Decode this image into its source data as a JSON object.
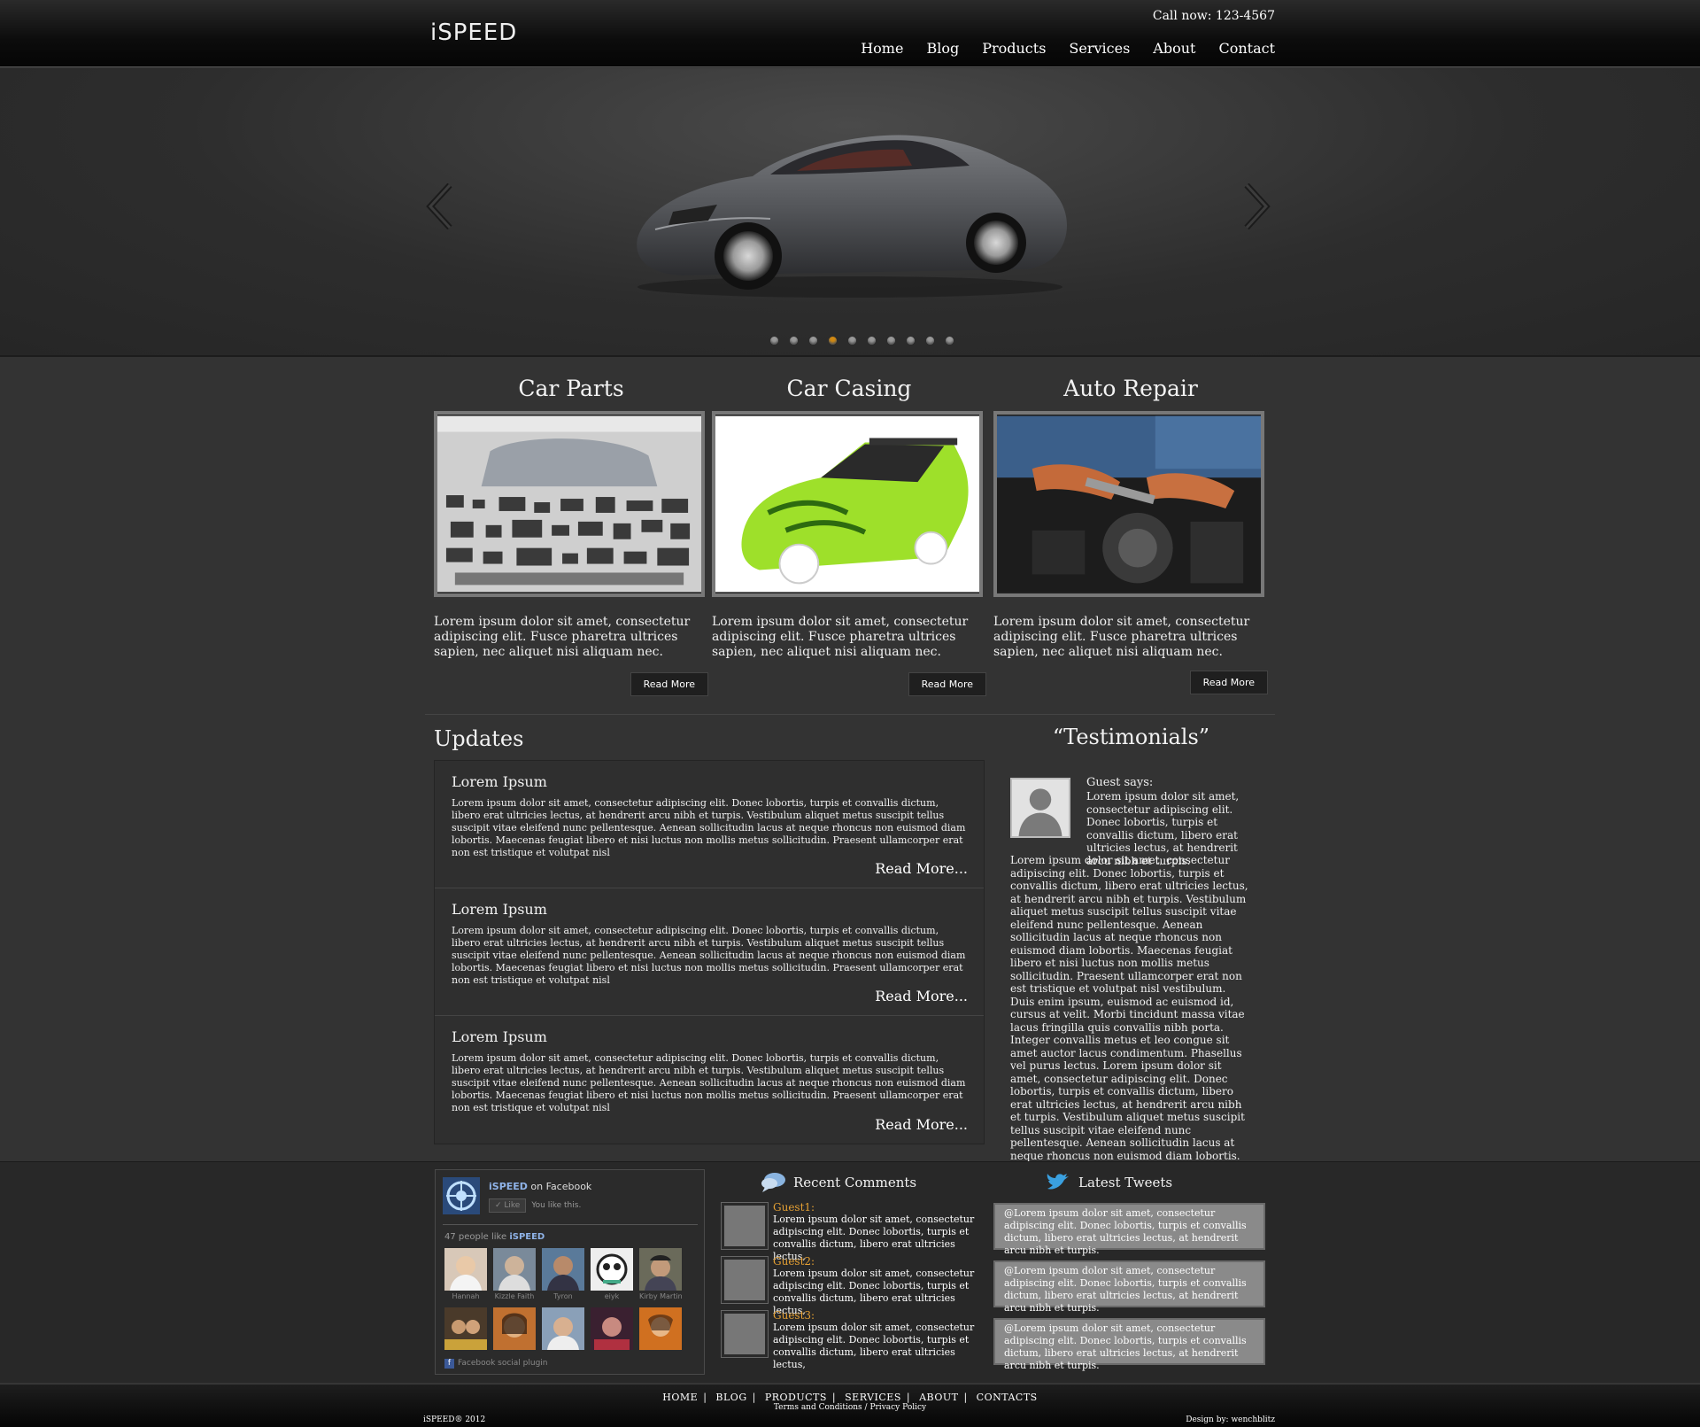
{
  "header": {
    "logo": "iSPEED",
    "call": "Call now: 123-4567",
    "nav": [
      "Home",
      "Blog",
      "Products",
      "Services",
      "About",
      "Contact"
    ]
  },
  "slider": {
    "total_dots": 10,
    "active_index": 3
  },
  "features": [
    {
      "title": "Car Parts",
      "text": "Lorem ipsum dolor sit amet, consectetur adipiscing elit. Fusce pharetra ultrices sapien, nec aliquet nisi aliquam nec.",
      "button": "Read More"
    },
    {
      "title": "Car Casing",
      "text": "Lorem ipsum dolor sit amet, consectetur adipiscing elit. Fusce pharetra ultrices sapien, nec aliquet nisi aliquam nec.",
      "button": "Read More"
    },
    {
      "title": "Auto Repair",
      "text": "Lorem ipsum dolor sit amet, consectetur adipiscing elit. Fusce pharetra ultrices sapien, nec aliquet nisi aliquam nec.",
      "button": "Read More"
    }
  ],
  "updates": {
    "title": "Updates",
    "items": [
      {
        "heading": "Lorem Ipsum",
        "body": "Lorem ipsum dolor sit amet, consectetur adipiscing elit. Donec lobortis, turpis et convallis dictum, libero erat ultricies lectus, at hendrerit arcu nibh et turpis. Vestibulum aliquet metus suscipit tellus suscipit vitae eleifend nunc pellentesque. Aenean sollicitudin lacus at neque rhoncus non euismod diam lobortis. Maecenas feugiat libero et nisi luctus non mollis metus sollicitudin. Praesent ullamcorper erat non est tristique et volutpat nisl",
        "more": "Read More..."
      },
      {
        "heading": "Lorem Ipsum",
        "body": "Lorem ipsum dolor sit amet, consectetur adipiscing elit. Donec lobortis, turpis et convallis dictum, libero erat ultricies lectus, at hendrerit arcu nibh et turpis. Vestibulum aliquet metus suscipit tellus suscipit vitae eleifend nunc pellentesque. Aenean sollicitudin lacus at neque rhoncus non euismod diam lobortis. Maecenas feugiat libero et nisi luctus non mollis metus sollicitudin. Praesent ullamcorper erat non est tristique et volutpat nisl",
        "more": "Read More..."
      },
      {
        "heading": "Lorem Ipsum",
        "body": "Lorem ipsum dolor sit amet, consectetur adipiscing elit. Donec lobortis, turpis et convallis dictum, libero erat ultricies lectus, at hendrerit arcu nibh et turpis. Vestibulum aliquet metus suscipit tellus suscipit vitae eleifend nunc pellentesque. Aenean sollicitudin lacus at neque rhoncus non euismod diam lobortis. Maecenas feugiat libero et nisi luctus non mollis metus sollicitudin. Praesent ullamcorper erat non est tristique et volutpat nisl",
        "more": "Read More..."
      }
    ]
  },
  "testimonials": {
    "title": "“Testimonials”",
    "name": "Guest says:",
    "lead": "Lorem ipsum dolor sit amet, consectetur adipiscing elit. Donec lobortis, turpis et convallis dictum, libero erat ultricies lectus, at hendrerit arcu nibh et turpis.",
    "body": "Lorem ipsum dolor sit amet, consectetur adipiscing elit. Donec lobortis, turpis et convallis dictum, libero erat ultricies lectus, at hendrerit arcu nibh et turpis. Vestibulum aliquet metus suscipit tellus suscipit vitae eleifend nunc pellentesque. Aenean sollicitudin lacus at neque rhoncus non euismod diam lobortis. Maecenas feugiat libero et nisi luctus non mollis metus sollicitudin. Praesent ullamcorper erat non est tristique et volutpat nisl vestibulum. Duis enim ipsum, euismod ac euismod id, cursus at velit. Morbi tincidunt massa vitae lacus fringilla quis convallis nibh porta. Integer convallis metus et leo congue sit amet auctor lacus condimentum. Phasellus vel purus lectus. Lorem ipsum dolor sit amet, consectetur adipiscing elit. Donec lobortis, turpis et convallis dictum, libero erat ultricies lectus, at hendrerit arcu nibh et turpis. Vestibulum aliquet metus suscipit tellus suscipit vitae eleifend nunc pellentesque. Aenean sollicitudin lacus at neque rhoncus non euismod diam lobortis. Maecenas feugiat libero et nisi"
  },
  "facebook": {
    "brand": "iSPEED",
    "on": "on Facebook",
    "like_button": "Like",
    "you_like": "You like this.",
    "count_prefix": "47 people like",
    "faces_row1": [
      "Hannah",
      "Kizzle Faith",
      "Tyron",
      "eiyk",
      "Kirby Martin"
    ],
    "plugin": "Facebook social plugin"
  },
  "recent_comments": {
    "title": "Recent Comments",
    "items": [
      {
        "name": "Guest1:",
        "text": "Lorem ipsum dolor sit amet, consectetur adipiscing elit. Donec lobortis, turpis et convallis dictum, libero erat ultricies lectus,"
      },
      {
        "name": "Guest2:",
        "text": "Lorem ipsum dolor sit amet, consectetur adipiscing elit. Donec lobortis, turpis et convallis dictum, libero erat ultricies lectus,"
      },
      {
        "name": "Guest3:",
        "text": "Lorem ipsum dolor sit amet, consectetur adipiscing elit. Donec lobortis, turpis et convallis dictum, libero erat ultricies lectus,"
      }
    ]
  },
  "latest_tweets": {
    "title": "Latest Tweets",
    "items": [
      "@Lorem ipsum dolor sit amet, consectetur adipiscing elit. Donec lobortis, turpis et convallis dictum, libero erat ultricies lectus, at hendrerit arcu nibh et turpis.",
      "@Lorem ipsum dolor sit amet, consectetur adipiscing elit. Donec lobortis, turpis et convallis dictum, libero erat ultricies lectus, at hendrerit arcu nibh et turpis.",
      "@Lorem ipsum dolor sit amet, consectetur adipiscing elit. Donec lobortis, turpis et convallis dictum, libero erat ultricies lectus, at hendrerit arcu nibh et turpis."
    ]
  },
  "footer": {
    "links": [
      "HOME",
      "BLOG",
      "PRODUCTS",
      "SERVICES",
      "ABOUT",
      "CONTACTS"
    ],
    "terms": "Terms and Conditions",
    "privacy": "Privacy Policy",
    "copyright": "iSPEED® 2012",
    "design": "Design by:  wenchblitz"
  },
  "colors": {
    "accent_dot": "#d28a12",
    "guest_name": "#e5a033",
    "fb_blue": "#8fb3e8"
  }
}
